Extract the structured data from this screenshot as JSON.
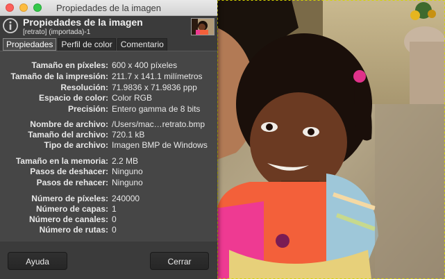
{
  "window": {
    "title": "Propiedades de la imagen"
  },
  "header": {
    "title": "Propiedades de la imagen",
    "subtitle": "[retrato] (importada)-1"
  },
  "tabs": [
    {
      "label": "Propiedades",
      "active": true
    },
    {
      "label": "Perfil de color",
      "active": false
    },
    {
      "label": "Comentario",
      "active": false
    }
  ],
  "properties": {
    "pixel_size": {
      "label": "Tamaño en píxeles:",
      "value": "600 x 400 píxeles"
    },
    "print_size": {
      "label": "Tamaño de la impresión:",
      "value": "211.7 x 141.1 milímetros"
    },
    "resolution": {
      "label": "Resolución:",
      "value": "71.9836 x 71.9836 ppp"
    },
    "color_space": {
      "label": "Espacio de color:",
      "value": "Color RGB"
    },
    "precision": {
      "label": "Precisión:",
      "value": "Entero gamma de 8 bits"
    },
    "file_name": {
      "label": "Nombre de archivo:",
      "value": "/Users/mac…retrato.bmp"
    },
    "file_size": {
      "label": "Tamaño del archivo:",
      "value": "720.1 kB"
    },
    "file_type": {
      "label": "Tipo de archivo:",
      "value": "Imagen BMP de Windows"
    },
    "memory_size": {
      "label": "Tamaño en la memoria:",
      "value": "2.2 MB"
    },
    "undo_steps": {
      "label": "Pasos de deshacer:",
      "value": "Ninguno"
    },
    "redo_steps": {
      "label": "Pasos de rehacer:",
      "value": "Ninguno"
    },
    "pixel_count": {
      "label": "Número de píxeles:",
      "value": "240000"
    },
    "layer_count": {
      "label": "Número de capas:",
      "value": "1"
    },
    "channel_count": {
      "label": "Número de canales:",
      "value": "0"
    },
    "path_count": {
      "label": "Número de rutas:",
      "value": "0"
    }
  },
  "buttons": {
    "help": "Ayuda",
    "close": "Cerrar"
  },
  "colors": {
    "dialog_bg": "#3b3b3b",
    "panel_bg": "#464646",
    "text": "#e8e8e8",
    "traffic_close": "#fc605b",
    "traffic_min": "#fdbc40",
    "traffic_max": "#34c84a",
    "selection_border": "#d6d600"
  },
  "icons": {
    "header": "info-icon",
    "thumbnail": "image-thumbnail"
  }
}
